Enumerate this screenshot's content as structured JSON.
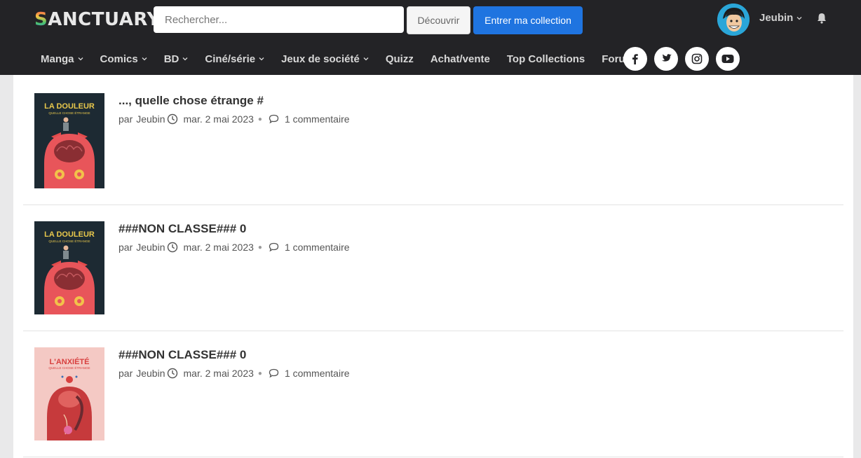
{
  "header": {
    "logo_text": "ANCTUARY",
    "logo_letter": "S",
    "search_placeholder": "Rechercher...",
    "discover_label": "Découvrir",
    "collection_label": "Entrer ma collection",
    "username": "Jeubin",
    "accent_color": "#1f74e0"
  },
  "nav": {
    "items": [
      {
        "label": "Manga",
        "dropdown": true
      },
      {
        "label": "Comics",
        "dropdown": true
      },
      {
        "label": "BD",
        "dropdown": true
      },
      {
        "label": "Ciné/série",
        "dropdown": true
      },
      {
        "label": "Jeux de société",
        "dropdown": true
      },
      {
        "label": "Quizz",
        "dropdown": false
      },
      {
        "label": "Achat/vente",
        "dropdown": false
      },
      {
        "label": "Top Collections",
        "dropdown": false
      },
      {
        "label": "Forum",
        "dropdown": false
      }
    ],
    "social": [
      "facebook-icon",
      "twitter-icon",
      "instagram-icon",
      "youtube-icon"
    ]
  },
  "posts": [
    {
      "title": "..., quelle chose étrange #",
      "author_prefix": "par",
      "author": "Jeubin",
      "date": "mar. 2 mai 2023",
      "comments": "1 commentaire",
      "cover": {
        "title": "LA DOULEUR",
        "subtitle": "QUELLE CHOSE ÉTRANGE",
        "theme": "dark"
      }
    },
    {
      "title": "###NON CLASSE### 0",
      "author_prefix": "par",
      "author": "Jeubin",
      "date": "mar. 2 mai 2023",
      "comments": "1 commentaire",
      "cover": {
        "title": "LA DOULEUR",
        "subtitle": "QUELLE CHOSE ÉTRANGE",
        "theme": "dark"
      }
    },
    {
      "title": "###NON CLASSE### 0",
      "author_prefix": "par",
      "author": "Jeubin",
      "date": "mar. 2 mai 2023",
      "comments": "1 commentaire",
      "cover": {
        "title": "L'ANXIÉTÉ",
        "subtitle": "QUELLE CHOSE ÉTRANGE",
        "theme": "pink"
      }
    }
  ]
}
